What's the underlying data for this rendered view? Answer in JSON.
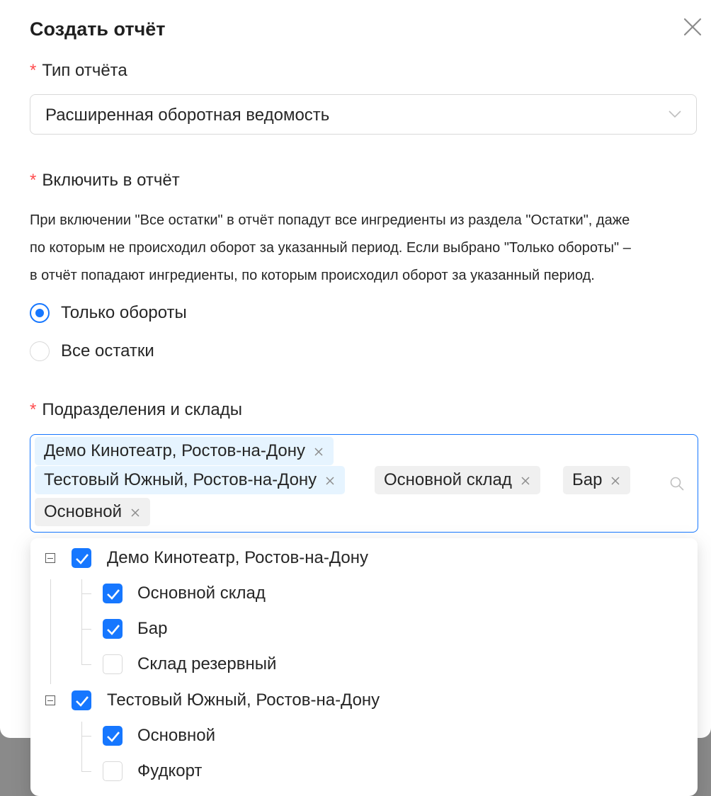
{
  "modal": {
    "title": "Создать отчёт"
  },
  "report_type": {
    "required_mark": "*",
    "label": "Тип отчёта",
    "value": "Расширенная оборотная ведомость"
  },
  "include": {
    "required_mark": "*",
    "label": "Включить в отчёт",
    "description_lines": [
      "При включении \"Все остатки\" в отчёт попадут все ингредиенты из раздела \"Остатки\", даже",
      "по которым не происходил оборот за указанный период. Если выбрано \"Только обороты\" –",
      "в отчёт попадают ингредиенты, по которым происходил оборот за указанный период."
    ],
    "options": [
      {
        "label": "Только обороты",
        "selected": true
      },
      {
        "label": "Все остатки",
        "selected": false
      }
    ]
  },
  "departments": {
    "required_mark": "*",
    "label": "Подразделения и склады",
    "tags": [
      "Демо Кинотеатр, Ростов-на-Дону",
      "Тестовый Южный, Ростов-на-Дону",
      "Основной склад",
      "Бар",
      "Основной"
    ],
    "tree": [
      {
        "label": "Демо Кинотеатр, Ростов-на-Дону",
        "checked": true,
        "expanded": true,
        "children": [
          {
            "label": "Основной склад",
            "checked": true
          },
          {
            "label": "Бар",
            "checked": true
          },
          {
            "label": "Склад резервный",
            "checked": false
          }
        ]
      },
      {
        "label": "Тестовый Южный, Ростов-на-Дону",
        "checked": true,
        "expanded": true,
        "children": [
          {
            "label": "Основной",
            "checked": true
          },
          {
            "label": "Фудкорт",
            "checked": false
          }
        ]
      }
    ]
  },
  "colors": {
    "accent": "#1677ff",
    "required": "#ff4d4f",
    "tag_selected_bg": "#e6f4ff",
    "tag_bg": "#f0f0f0"
  }
}
